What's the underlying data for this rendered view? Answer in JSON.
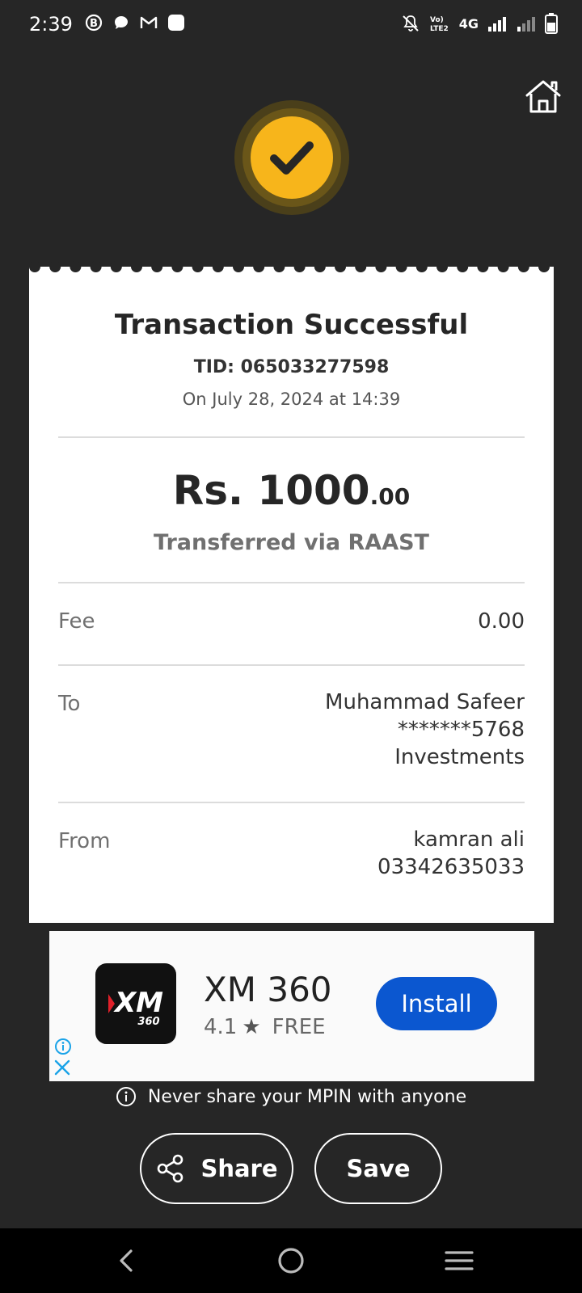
{
  "status_bar": {
    "time": "2:39",
    "network": "4G",
    "volte": "Vo) LTE2"
  },
  "receipt": {
    "title": "Transaction Successful",
    "tid": "TID: 065033277598",
    "date": "On July 28, 2024 at 14:39",
    "amount_currency": "Rs. ",
    "amount_main": "1000",
    "amount_decimal": ".00",
    "transfer_method": "Transferred via RAAST",
    "fee_label": "Fee",
    "fee_value": "0.00",
    "to_label": "To",
    "to_name": "Muhammad Safeer",
    "to_account": "*******5768",
    "to_bank": "Investments",
    "from_label": "From",
    "from_name": "kamran ali",
    "from_number": "03342635033"
  },
  "ad": {
    "app_name": "XM 360",
    "rating": "4.1",
    "price": "FREE",
    "install_label": "Install",
    "logo_text": "XM",
    "logo_subtext": "360"
  },
  "notice": "Never share your MPIN with anyone",
  "buttons": {
    "share_label": "Share",
    "save_label": "Save"
  },
  "colors": {
    "background": "#262626",
    "accent": "#f7b51b",
    "install_blue": "#0b57d0"
  },
  "icons": [
    "home-icon",
    "check-icon",
    "share-icon",
    "info-icon",
    "close-icon",
    "back-icon",
    "home-circle-icon",
    "recents-icon"
  ]
}
